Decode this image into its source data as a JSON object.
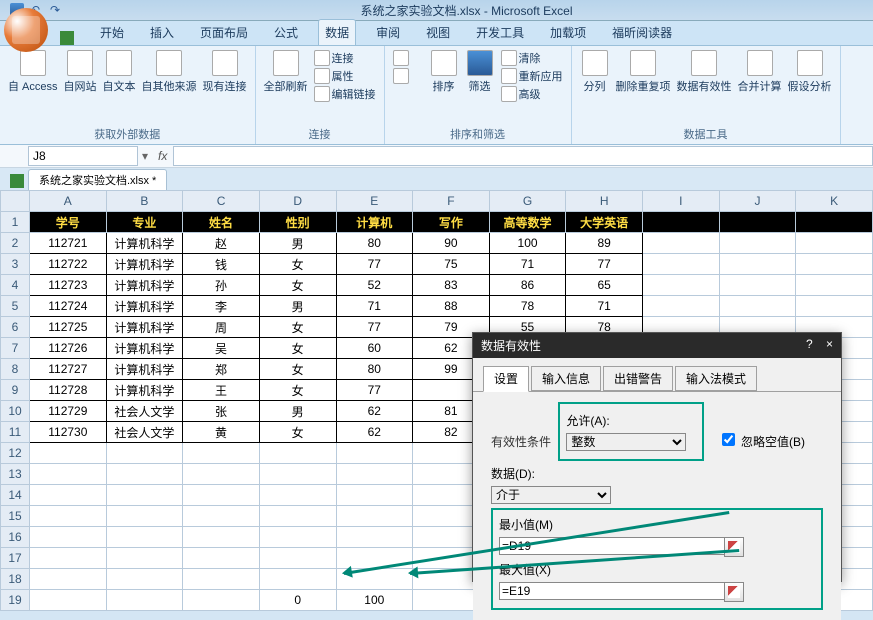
{
  "titlebar": {
    "title": "系统之家实验文档.xlsx - Microsoft Excel"
  },
  "tabs": [
    "开始",
    "插入",
    "页面布局",
    "公式",
    "数据",
    "审阅",
    "视图",
    "开发工具",
    "加载项",
    "福昕阅读器"
  ],
  "active_tab": 4,
  "ribbon": {
    "groups": [
      {
        "label": "获取外部数据",
        "items": [
          "自 Access",
          "自网站",
          "自文本",
          "自其他来源",
          "现有连接"
        ]
      },
      {
        "label": "连接",
        "items": [
          "全部刷新"
        ],
        "sub": [
          "连接",
          "属性",
          "编辑链接"
        ]
      },
      {
        "label": "排序和筛选",
        "items": [
          "排序",
          "筛选"
        ],
        "sub": [
          "清除",
          "重新应用",
          "高级"
        ]
      },
      {
        "label": "数据工具",
        "items": [
          "分列",
          "删除重复项",
          "数据有效性",
          "合并计算",
          "假设分析"
        ]
      }
    ],
    "sort_az": "A↓Z",
    "sort_za": "Z↓A"
  },
  "namebox": {
    "cell": "J8"
  },
  "booktab": "系统之家实验文档.xlsx *",
  "cols": [
    "A",
    "B",
    "C",
    "D",
    "E",
    "F",
    "G",
    "H",
    "I",
    "J",
    "K"
  ],
  "rows": [
    1,
    2,
    3,
    4,
    5,
    6,
    7,
    8,
    9,
    10,
    11,
    12,
    13,
    14,
    15,
    16,
    17,
    18,
    19
  ],
  "headers": [
    "学号",
    "专业",
    "姓名",
    "性别",
    "计算机",
    "写作",
    "高等数学",
    "大学英语"
  ],
  "data": [
    [
      "112721",
      "计算机科学",
      "赵",
      "男",
      "80",
      "90",
      "100",
      "89"
    ],
    [
      "112722",
      "计算机科学",
      "钱",
      "女",
      "77",
      "75",
      "71",
      "77"
    ],
    [
      "112723",
      "计算机科学",
      "孙",
      "女",
      "52",
      "83",
      "86",
      "65"
    ],
    [
      "112724",
      "计算机科学",
      "李",
      "男",
      "71",
      "88",
      "78",
      "71"
    ],
    [
      "112725",
      "计算机科学",
      "周",
      "女",
      "77",
      "79",
      "55",
      "78"
    ],
    [
      "112726",
      "计算机科学",
      "吴",
      "女",
      "60",
      "62",
      "",
      ""
    ],
    [
      "112727",
      "计算机科学",
      "郑",
      "女",
      "80",
      "99",
      "",
      ""
    ],
    [
      "112728",
      "计算机科学",
      "王",
      "女",
      "77",
      "",
      "",
      ""
    ],
    [
      "112729",
      "社会人文学",
      "张",
      "男",
      "62",
      "81",
      "",
      ""
    ],
    [
      "112730",
      "社会人文学",
      "黄",
      "女",
      "62",
      "82",
      "",
      ""
    ]
  ],
  "row19": {
    "d": "0",
    "e": "100"
  },
  "dialog": {
    "title": "数据有效性",
    "close": "×",
    "help": "?",
    "tabs": [
      "设置",
      "输入信息",
      "出错警告",
      "输入法模式"
    ],
    "active_tab": 0,
    "fieldset_label": "有效性条件",
    "allow_label": "允许(A):",
    "allow_value": "整数",
    "ignore_blank": "忽略空值(B)",
    "data_label": "数据(D):",
    "data_value": "介于",
    "min_label": "最小值(M)",
    "min_value": "=D19",
    "max_label": "最大值(X)",
    "max_value": "=E19"
  }
}
